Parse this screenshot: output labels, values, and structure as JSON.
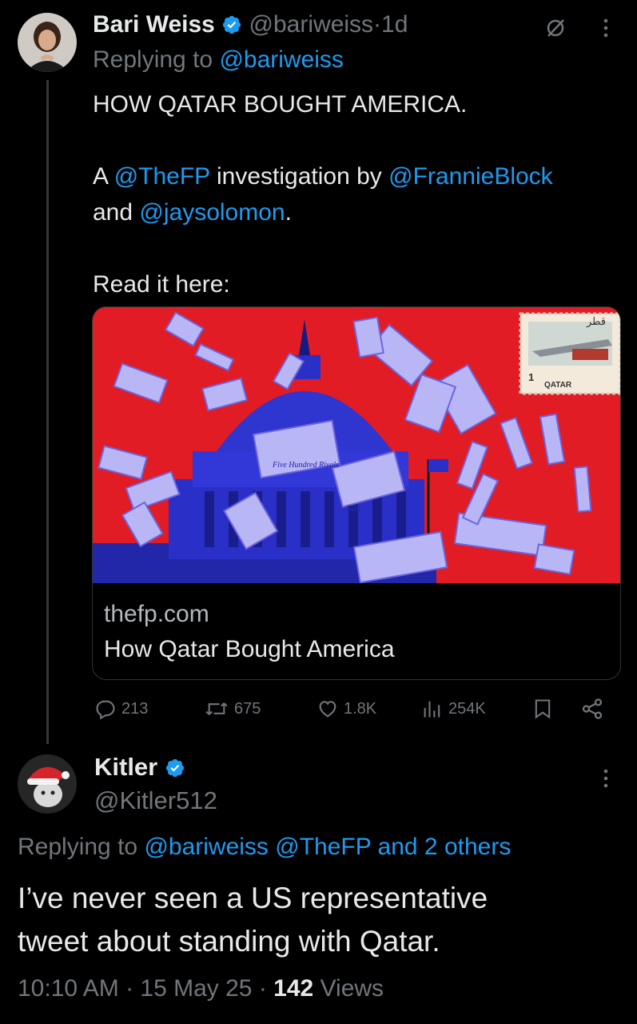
{
  "tweet1": {
    "name": "Bari Weiss",
    "handle": "@bariweiss",
    "separator": "·",
    "time": "1d",
    "replying_prefix": "Replying to",
    "replying_to": "@bariweiss",
    "line1": "HOW QATAR BOUGHT AMERICA.",
    "line2_a": "A",
    "line2_mention1": "@TheFP",
    "line2_b": "investigation by",
    "line2_mention2": "@FrannieBlock",
    "line3_a": "and",
    "line3_mention": "@jaysolomon",
    "line3_b": ".",
    "line4": "Read it here:",
    "card": {
      "domain": "thefp.com",
      "title": "How Qatar Bought America",
      "stamp_text": "QATAR",
      "stamp_arabic": "قطر",
      "stamp_value": "1",
      "banknote_text": "Five Hundred Riyals",
      "banknote_value": "500"
    },
    "actions": {
      "replies": "213",
      "reposts": "675",
      "likes": "1.8K",
      "views": "254K"
    }
  },
  "tweet2": {
    "name": "Kitler",
    "handle": "@Kitler512",
    "replying_prefix": "Replying to",
    "replying_mentions": "@bariweiss @TheFP and 2 others",
    "text_line1": "I’ve never seen a US representative",
    "text_line2": "tweet about standing with Qatar.",
    "timestamp": "10:10 AM · 15 May 25 ·",
    "views_count": "142",
    "views_label": "Views"
  },
  "colors": {
    "accent": "#1d9bf0",
    "muted": "#71767b",
    "text": "#e7e9ea",
    "background": "#000000",
    "card_image_red": "#e21c24",
    "capitol_blue": "#2a2fc8"
  },
  "icons": [
    "verified-badge-icon",
    "mute-icon",
    "more-icon",
    "reply-icon",
    "repost-icon",
    "like-icon",
    "views-icon",
    "bookmark-icon",
    "share-icon"
  ]
}
